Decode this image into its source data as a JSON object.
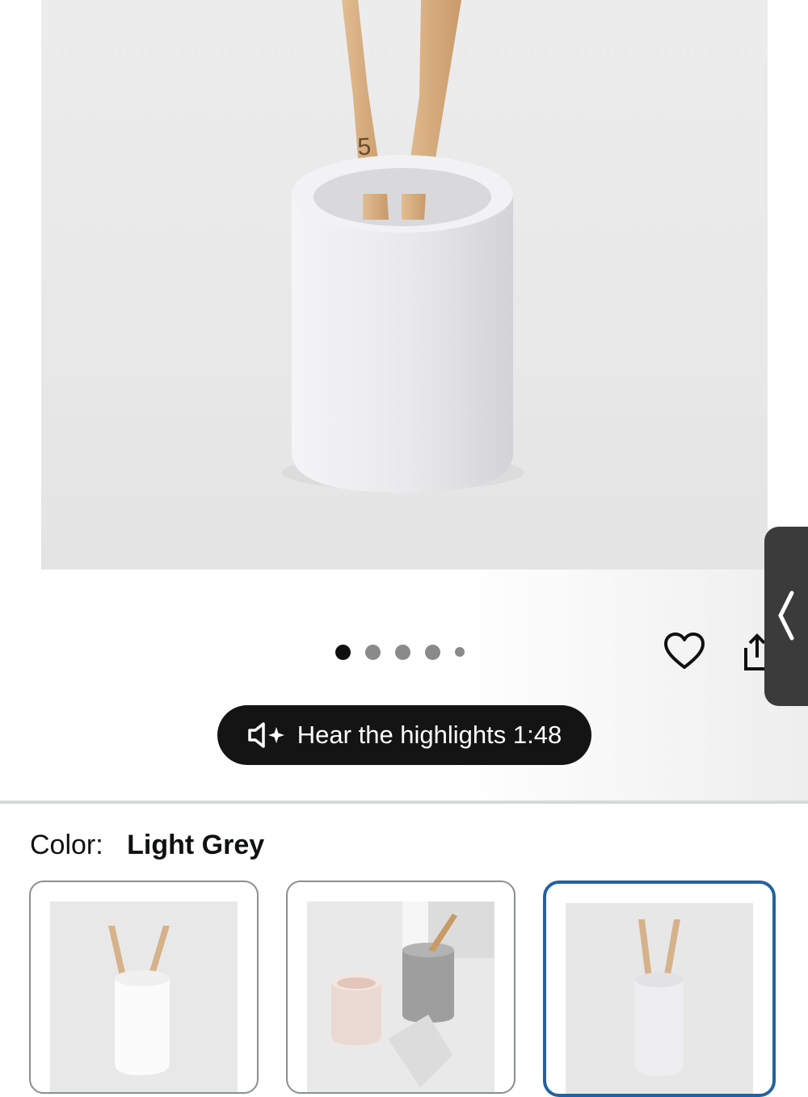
{
  "gallery": {
    "image_alt": "White cylindrical toothbrush holder with two bamboo toothbrushes",
    "dots_count": 5,
    "active_dot": 0
  },
  "actions": {
    "favorite_icon": "heart-icon",
    "share_icon": "share-icon"
  },
  "side_panel": {
    "icon": "chevron-left-icon"
  },
  "audio": {
    "label": "Hear the highlights 1:48",
    "icon": "speaker-sparkle-icon"
  },
  "variation": {
    "label": "Color:",
    "value": "Light Grey",
    "options": [
      {
        "name": "White",
        "selected": false
      },
      {
        "name": "Set",
        "selected": false
      },
      {
        "name": "Light Grey",
        "selected": true
      }
    ]
  },
  "colors": {
    "selected_border": "#2162a1",
    "pill_bg": "#141414"
  }
}
